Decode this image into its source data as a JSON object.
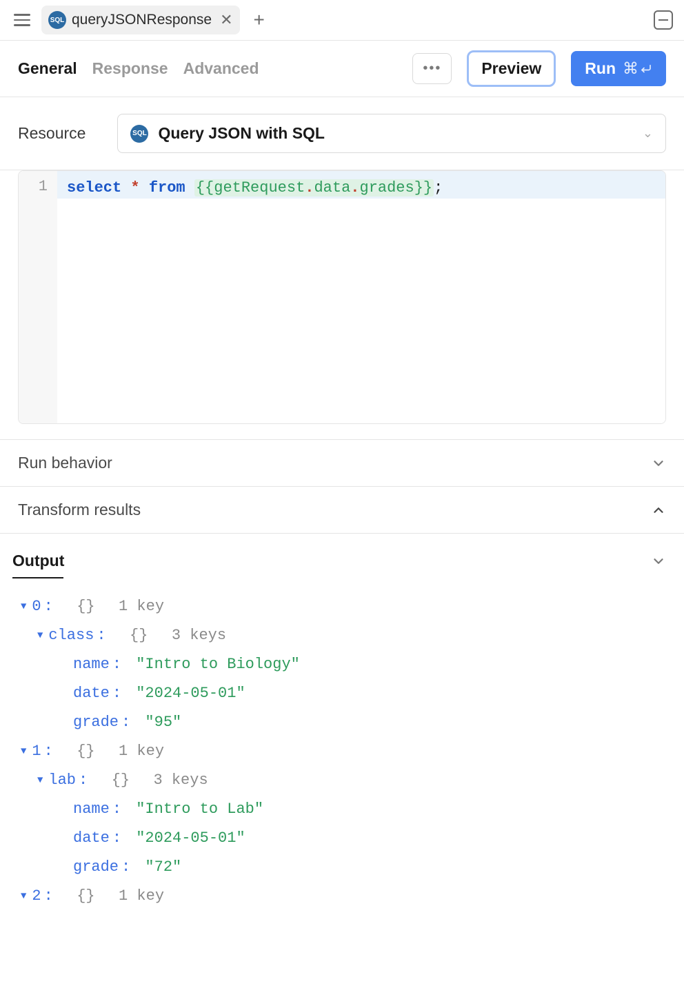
{
  "topbar": {
    "tab_title": "queryJSONResponse",
    "sql_badge": "SQL"
  },
  "subtabs": {
    "general": "General",
    "response": "Response",
    "advanced": "Advanced"
  },
  "actions": {
    "preview": "Preview",
    "run": "Run",
    "shortcut_cmd": "⌘",
    "shortcut_enter": "↵"
  },
  "resource": {
    "label": "Resource",
    "selected": "Query JSON with SQL"
  },
  "editor": {
    "line_number": "1",
    "code": {
      "kw_select": "select",
      "star": "*",
      "kw_from": "from",
      "open": "{{",
      "obj": "getRequest",
      "dot1": ".",
      "prop1": "data",
      "dot2": ".",
      "prop2": "grades",
      "close": "}}",
      "semi": ";"
    }
  },
  "sections": {
    "run_behavior": "Run behavior",
    "transform_results": "Transform results",
    "output": "Output"
  },
  "output": {
    "items": [
      {
        "index": "0",
        "meta_count": "1 key",
        "child_key": "class",
        "child_meta": "3 keys",
        "fields": {
          "name_key": "name",
          "name_val": "\"Intro to Biology\"",
          "date_key": "date",
          "date_val": "\"2024-05-01\"",
          "grade_key": "grade",
          "grade_val": "\"95\""
        }
      },
      {
        "index": "1",
        "meta_count": "1 key",
        "child_key": "lab",
        "child_meta": "3 keys",
        "fields": {
          "name_key": "name",
          "name_val": "\"Intro to Lab\"",
          "date_key": "date",
          "date_val": "\"2024-05-01\"",
          "grade_key": "grade",
          "grade_val": "\"72\""
        }
      },
      {
        "index": "2",
        "meta_count": "1 key"
      }
    ],
    "braces": "{}"
  }
}
